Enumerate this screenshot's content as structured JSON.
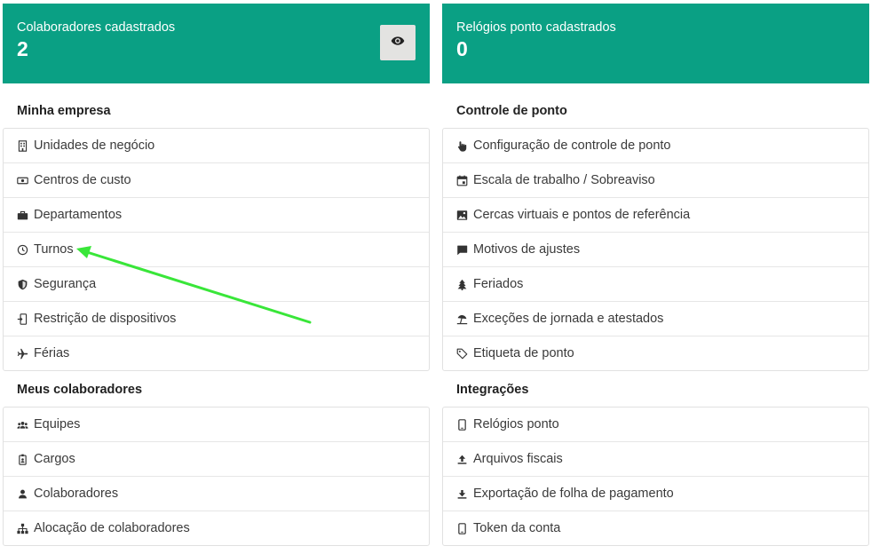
{
  "stats": {
    "collaborators": {
      "label": "Colaboradores cadastrados",
      "value": "2"
    },
    "clocks": {
      "label": "Relógios ponto cadastrados",
      "value": "0"
    }
  },
  "company": {
    "title": "Minha empresa",
    "items": [
      {
        "label": "Unidades de negócio",
        "icon": "building-icon"
      },
      {
        "label": "Centros de custo",
        "icon": "money-icon"
      },
      {
        "label": "Departamentos",
        "icon": "briefcase-icon"
      },
      {
        "label": "Turnos",
        "icon": "clock-icon"
      },
      {
        "label": "Segurança",
        "icon": "shield-icon"
      },
      {
        "label": "Restrição de dispositivos",
        "icon": "device-lock-icon"
      },
      {
        "label": "Férias",
        "icon": "airplane-icon"
      }
    ]
  },
  "collaborators": {
    "title": "Meus colaboradores",
    "items": [
      {
        "label": "Equipes",
        "icon": "team-icon"
      },
      {
        "label": "Cargos",
        "icon": "badge-icon"
      },
      {
        "label": "Colaboradores",
        "icon": "user-icon"
      },
      {
        "label": "Alocação de colaboradores",
        "icon": "hierarchy-icon"
      }
    ]
  },
  "timeControl": {
    "title": "Controle de ponto",
    "items": [
      {
        "label": "Configuração de controle de ponto",
        "icon": "pointer-hand-icon"
      },
      {
        "label": "Escala de trabalho / Sobreaviso",
        "icon": "calendar-icon"
      },
      {
        "label": "Cercas virtuais e pontos de referência",
        "icon": "map-image-icon"
      },
      {
        "label": "Motivos de ajustes",
        "icon": "comment-icon"
      },
      {
        "label": "Feriados",
        "icon": "tree-icon"
      },
      {
        "label": "Exceções de jornada e atestados",
        "icon": "umbrella-beach-icon"
      },
      {
        "label": "Etiqueta de ponto",
        "icon": "tag-icon"
      }
    ]
  },
  "integrations": {
    "title": "Integrações",
    "items": [
      {
        "label": "Relógios ponto",
        "icon": "mobile-icon"
      },
      {
        "label": "Arquivos fiscais",
        "icon": "upload-icon"
      },
      {
        "label": "Exportação de folha de pagamento",
        "icon": "download-icon"
      },
      {
        "label": "Token da conta",
        "icon": "mobile-icon"
      }
    ]
  },
  "colors": {
    "accent": "#0aa084",
    "annotationArrow": "#39e639"
  }
}
